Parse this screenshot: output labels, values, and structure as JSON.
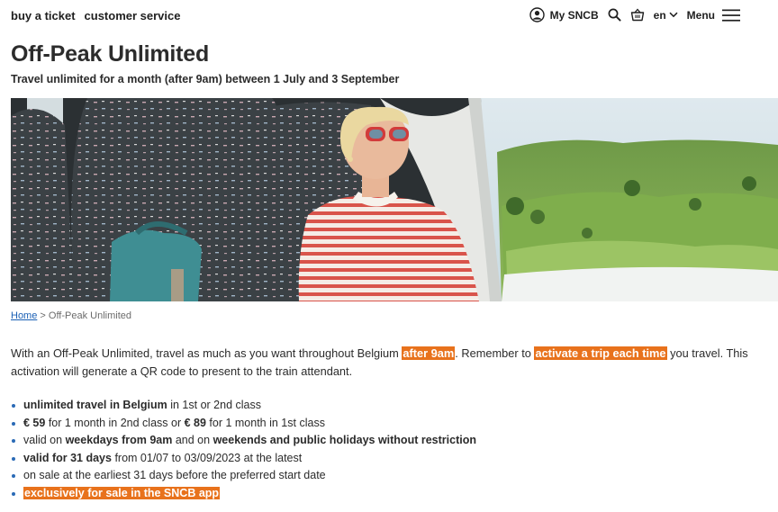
{
  "header": {
    "nav": [
      "buy a ticket",
      "customer service"
    ],
    "account_label": "My SNCB",
    "language": "en",
    "menu_label": "Menu"
  },
  "page": {
    "title": "Off-Peak Unlimited",
    "subtitle": "Travel unlimited for a month (after 9am) between 1 July and 3 September"
  },
  "breadcrumb": {
    "home": "Home",
    "separator": " > ",
    "current": "Off-Peak Unlimited"
  },
  "intro": {
    "t1": "With an Off-Peak Unlimited, travel as much as you want throughout Belgium ",
    "h1": "after 9am",
    "t2": ". Remember to ",
    "h2": "activate a trip each time",
    "t3": " you travel. This activation will generate a QR code to present to the train attendant."
  },
  "features": {
    "f1": {
      "b1": "unlimited travel in Belgium",
      "t1": " in 1st or 2nd class"
    },
    "f2": {
      "b1": "€ 59",
      "t1": " for 1 month in 2nd class or ",
      "b2": "€ 89",
      "t2": " for 1 month in 1st class"
    },
    "f3": {
      "t1": "valid on ",
      "b1": "weekdays from 9am",
      "t2": " and on ",
      "b2": "weekends and public holidays without restriction"
    },
    "f4": {
      "b1": "valid for 31 days",
      "t1": " from 01/07 to 03/09/2023 at the latest"
    },
    "f5": {
      "t1": "on sale at the earliest 31 days before the preferred start date"
    },
    "f6": {
      "h1": "exclusively for sale in the SNCB app"
    }
  },
  "colors": {
    "highlight": "#e8721c",
    "link": "#1a5fb4",
    "bullet": "#2a6ab6"
  },
  "icons": [
    "user-icon",
    "search-icon",
    "basket-icon",
    "chevron-down-icon",
    "hamburger-icon"
  ]
}
